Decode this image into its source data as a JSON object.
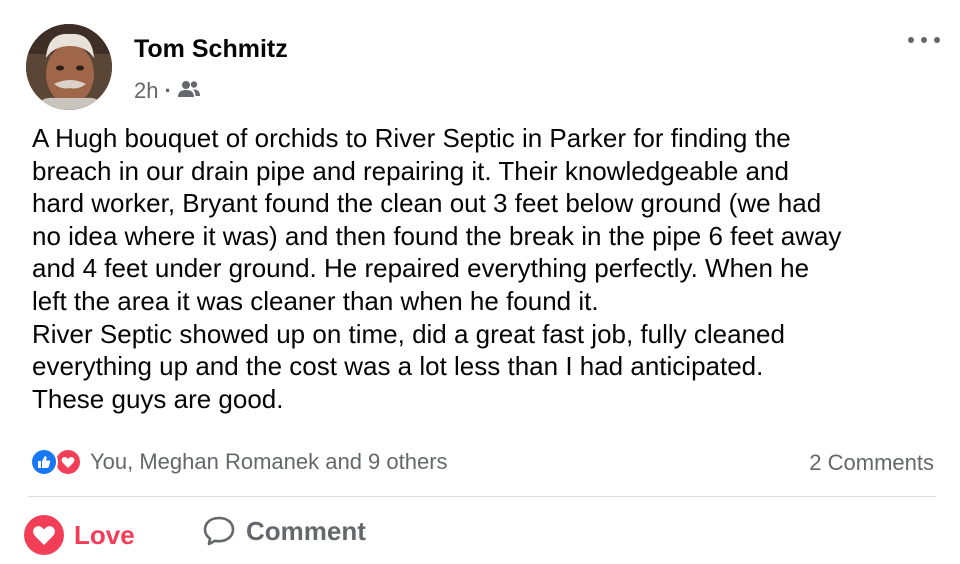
{
  "post": {
    "author": "Tom Schmitz",
    "time": "2h",
    "separator": "·",
    "audience_icon": "friends-icon",
    "lines": [
      "A Hugh bouquet of orchids to River Septic in Parker  for finding the",
      "breach in our drain pipe and repairing it. Their knowledgeable and",
      "hard worker, Bryant found the clean out 3 feet below ground (we had",
      "no idea where it was) and then found the break in the pipe 6 feet away",
      "and 4 feet under ground. He repaired everything perfectly. When he",
      "left the area it was cleaner than when he found it.",
      "River Septic showed up on time, did a great fast job, fully cleaned",
      "everything up and the cost was a lot less than I had anticipated.",
      "These guys are good."
    ]
  },
  "reactions": {
    "icons": [
      "like-icon",
      "love-icon"
    ],
    "summary": "You, Meghan Romanek and 9 others",
    "comments": "2 Comments"
  },
  "actions": {
    "love_label": "Love",
    "comment_label": "Comment"
  },
  "colors": {
    "love": "#f33e58",
    "like": "#1877f2",
    "secondary_text": "#65676b",
    "divider": "#dadde1"
  }
}
